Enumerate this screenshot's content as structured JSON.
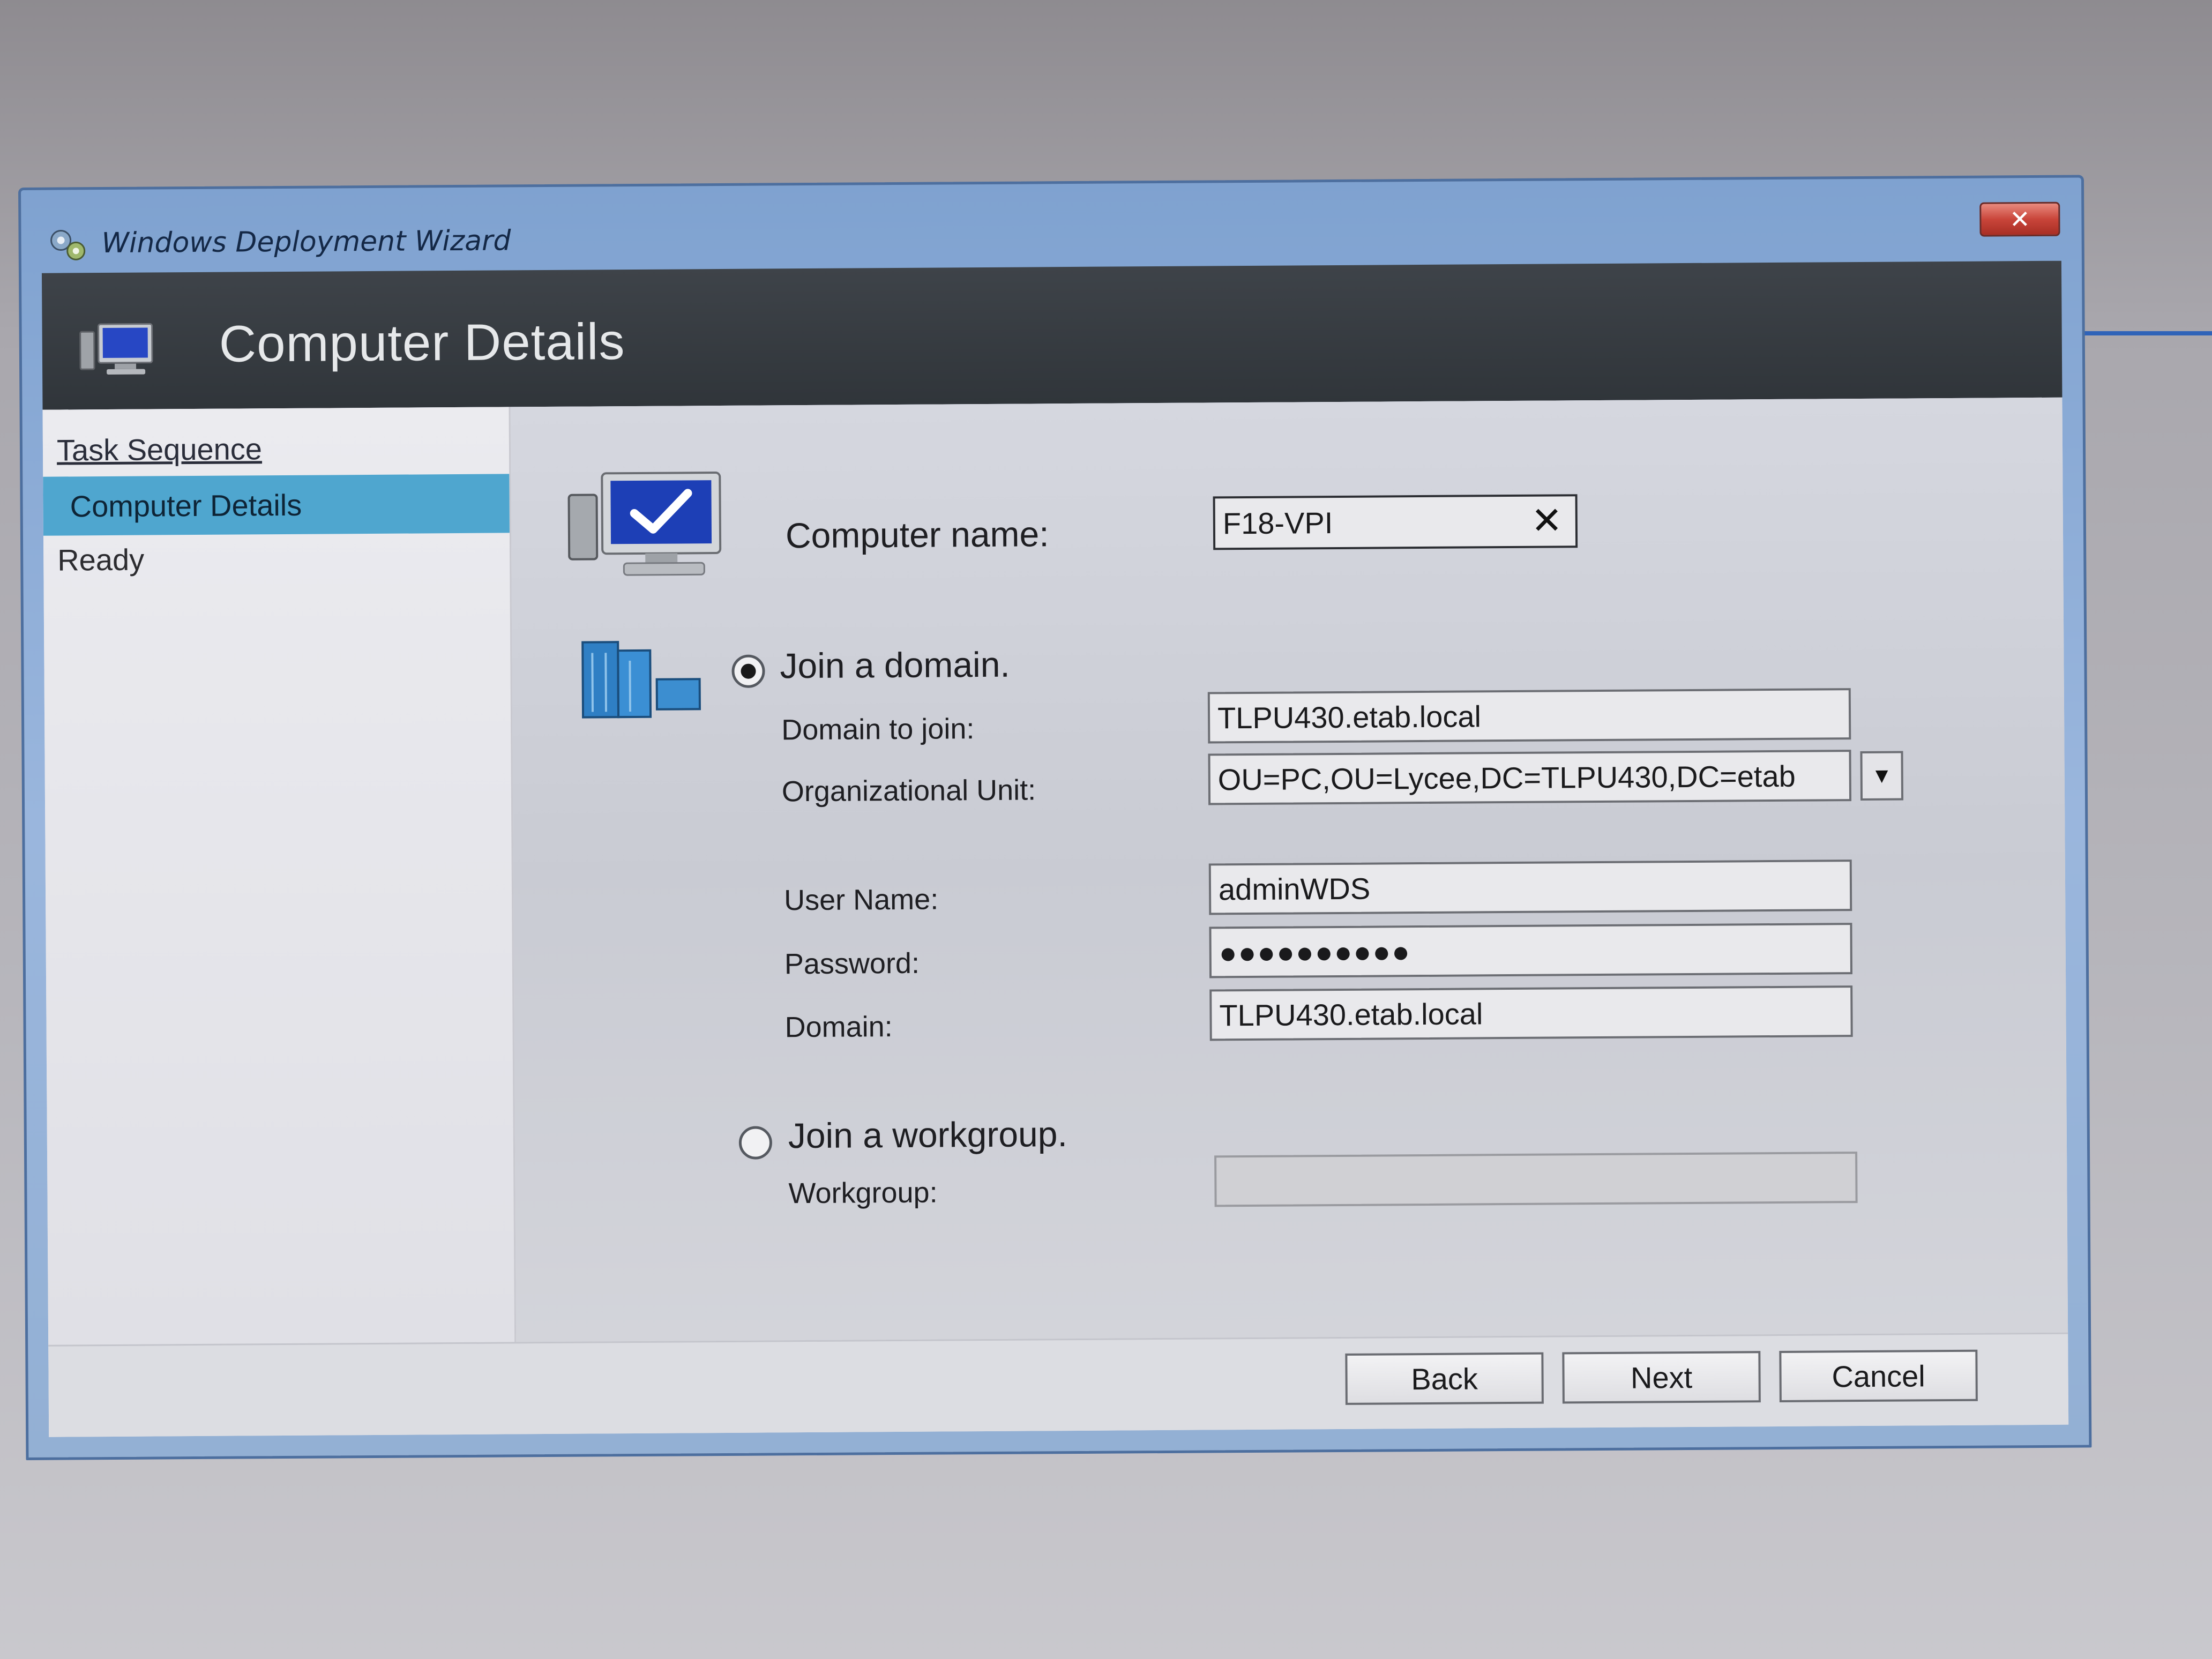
{
  "window": {
    "title": "Windows Deployment Wizard",
    "close_glyph": "✕"
  },
  "banner": {
    "title": "Computer Details"
  },
  "sidebar": {
    "items": [
      {
        "label": "Task Sequence",
        "state": "link"
      },
      {
        "label": "Computer Details",
        "state": "selected"
      },
      {
        "label": "Ready",
        "state": "normal"
      }
    ]
  },
  "form": {
    "computer_name": {
      "label": "Computer name:",
      "value": "F18-VPI",
      "clear_glyph": "✕"
    },
    "join_domain": {
      "label": "Join a domain.",
      "checked": true
    },
    "domain_to_join": {
      "label": "Domain to join:",
      "value": "TLPU430.etab.local"
    },
    "organizational_unit": {
      "label": "Organizational Unit:",
      "value": "OU=PC,OU=Lycee,DC=TLPU430,DC=etab",
      "dropdown_glyph": "▼"
    },
    "user_name": {
      "label": "User Name:",
      "value": "adminWDS"
    },
    "password": {
      "label": "Password:",
      "value": "●●●●●●●●●●"
    },
    "domain": {
      "label": "Domain:",
      "value": "TLPU430.etab.local"
    },
    "join_workgroup": {
      "label": "Join a workgroup.",
      "checked": false
    },
    "workgroup": {
      "label": "Workgroup:",
      "value": ""
    }
  },
  "buttons": {
    "back": "Back",
    "next": "Next",
    "cancel": "Cancel"
  },
  "icons": [
    "wizard-icon",
    "computer-icon",
    "computer-check-icon",
    "domain-server-icon",
    "close-icon",
    "clear-icon",
    "chevron-down-icon"
  ]
}
